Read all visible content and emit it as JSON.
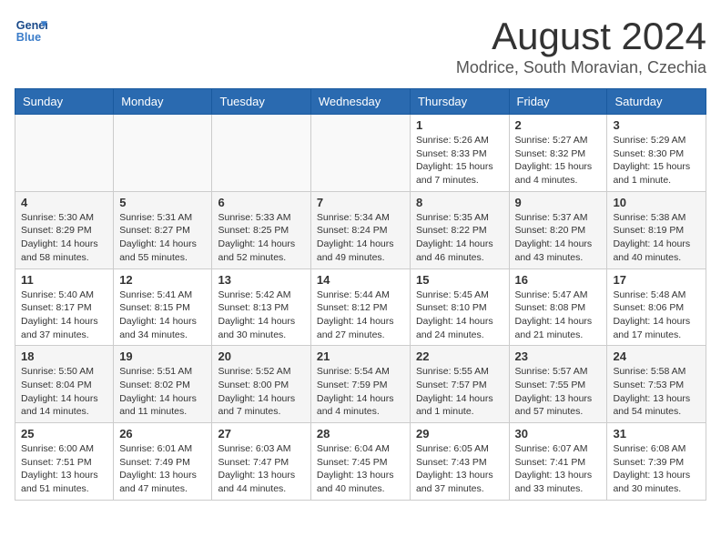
{
  "header": {
    "logo_line1": "General",
    "logo_line2": "Blue",
    "month_title": "August 2024",
    "subtitle": "Modrice, South Moravian, Czechia"
  },
  "days_of_week": [
    "Sunday",
    "Monday",
    "Tuesday",
    "Wednesday",
    "Thursday",
    "Friday",
    "Saturday"
  ],
  "weeks": [
    [
      {
        "day": "",
        "info": ""
      },
      {
        "day": "",
        "info": ""
      },
      {
        "day": "",
        "info": ""
      },
      {
        "day": "",
        "info": ""
      },
      {
        "day": "1",
        "info": "Sunrise: 5:26 AM\nSunset: 8:33 PM\nDaylight: 15 hours\nand 7 minutes."
      },
      {
        "day": "2",
        "info": "Sunrise: 5:27 AM\nSunset: 8:32 PM\nDaylight: 15 hours\nand 4 minutes."
      },
      {
        "day": "3",
        "info": "Sunrise: 5:29 AM\nSunset: 8:30 PM\nDaylight: 15 hours\nand 1 minute."
      }
    ],
    [
      {
        "day": "4",
        "info": "Sunrise: 5:30 AM\nSunset: 8:29 PM\nDaylight: 14 hours\nand 58 minutes."
      },
      {
        "day": "5",
        "info": "Sunrise: 5:31 AM\nSunset: 8:27 PM\nDaylight: 14 hours\nand 55 minutes."
      },
      {
        "day": "6",
        "info": "Sunrise: 5:33 AM\nSunset: 8:25 PM\nDaylight: 14 hours\nand 52 minutes."
      },
      {
        "day": "7",
        "info": "Sunrise: 5:34 AM\nSunset: 8:24 PM\nDaylight: 14 hours\nand 49 minutes."
      },
      {
        "day": "8",
        "info": "Sunrise: 5:35 AM\nSunset: 8:22 PM\nDaylight: 14 hours\nand 46 minutes."
      },
      {
        "day": "9",
        "info": "Sunrise: 5:37 AM\nSunset: 8:20 PM\nDaylight: 14 hours\nand 43 minutes."
      },
      {
        "day": "10",
        "info": "Sunrise: 5:38 AM\nSunset: 8:19 PM\nDaylight: 14 hours\nand 40 minutes."
      }
    ],
    [
      {
        "day": "11",
        "info": "Sunrise: 5:40 AM\nSunset: 8:17 PM\nDaylight: 14 hours\nand 37 minutes."
      },
      {
        "day": "12",
        "info": "Sunrise: 5:41 AM\nSunset: 8:15 PM\nDaylight: 14 hours\nand 34 minutes."
      },
      {
        "day": "13",
        "info": "Sunrise: 5:42 AM\nSunset: 8:13 PM\nDaylight: 14 hours\nand 30 minutes."
      },
      {
        "day": "14",
        "info": "Sunrise: 5:44 AM\nSunset: 8:12 PM\nDaylight: 14 hours\nand 27 minutes."
      },
      {
        "day": "15",
        "info": "Sunrise: 5:45 AM\nSunset: 8:10 PM\nDaylight: 14 hours\nand 24 minutes."
      },
      {
        "day": "16",
        "info": "Sunrise: 5:47 AM\nSunset: 8:08 PM\nDaylight: 14 hours\nand 21 minutes."
      },
      {
        "day": "17",
        "info": "Sunrise: 5:48 AM\nSunset: 8:06 PM\nDaylight: 14 hours\nand 17 minutes."
      }
    ],
    [
      {
        "day": "18",
        "info": "Sunrise: 5:50 AM\nSunset: 8:04 PM\nDaylight: 14 hours\nand 14 minutes."
      },
      {
        "day": "19",
        "info": "Sunrise: 5:51 AM\nSunset: 8:02 PM\nDaylight: 14 hours\nand 11 minutes."
      },
      {
        "day": "20",
        "info": "Sunrise: 5:52 AM\nSunset: 8:00 PM\nDaylight: 14 hours\nand 7 minutes."
      },
      {
        "day": "21",
        "info": "Sunrise: 5:54 AM\nSunset: 7:59 PM\nDaylight: 14 hours\nand 4 minutes."
      },
      {
        "day": "22",
        "info": "Sunrise: 5:55 AM\nSunset: 7:57 PM\nDaylight: 14 hours\nand 1 minute."
      },
      {
        "day": "23",
        "info": "Sunrise: 5:57 AM\nSunset: 7:55 PM\nDaylight: 13 hours\nand 57 minutes."
      },
      {
        "day": "24",
        "info": "Sunrise: 5:58 AM\nSunset: 7:53 PM\nDaylight: 13 hours\nand 54 minutes."
      }
    ],
    [
      {
        "day": "25",
        "info": "Sunrise: 6:00 AM\nSunset: 7:51 PM\nDaylight: 13 hours\nand 51 minutes."
      },
      {
        "day": "26",
        "info": "Sunrise: 6:01 AM\nSunset: 7:49 PM\nDaylight: 13 hours\nand 47 minutes."
      },
      {
        "day": "27",
        "info": "Sunrise: 6:03 AM\nSunset: 7:47 PM\nDaylight: 13 hours\nand 44 minutes."
      },
      {
        "day": "28",
        "info": "Sunrise: 6:04 AM\nSunset: 7:45 PM\nDaylight: 13 hours\nand 40 minutes."
      },
      {
        "day": "29",
        "info": "Sunrise: 6:05 AM\nSunset: 7:43 PM\nDaylight: 13 hours\nand 37 minutes."
      },
      {
        "day": "30",
        "info": "Sunrise: 6:07 AM\nSunset: 7:41 PM\nDaylight: 13 hours\nand 33 minutes."
      },
      {
        "day": "31",
        "info": "Sunrise: 6:08 AM\nSunset: 7:39 PM\nDaylight: 13 hours\nand 30 minutes."
      }
    ]
  ]
}
